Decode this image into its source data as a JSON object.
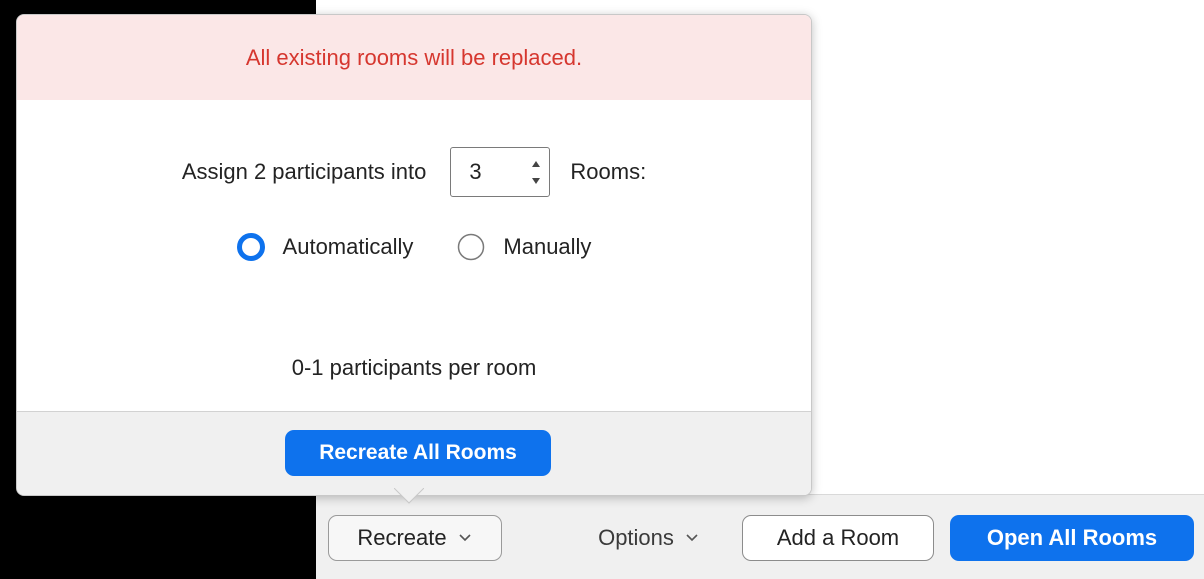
{
  "popover": {
    "warning": "All existing rooms will be replaced.",
    "assign_prefix": "Assign 2 participants into",
    "rooms_count": "3",
    "rooms_suffix": "Rooms:",
    "options": [
      {
        "label": "Automatically",
        "selected": true
      },
      {
        "label": "Manually",
        "selected": false
      }
    ],
    "per_room_text": "0-1 participants per room",
    "primary_button": "Recreate All Rooms"
  },
  "toolbar": {
    "recreate_label": "Recreate",
    "options_label": "Options",
    "add_room_label": "Add a Room",
    "open_all_label": "Open All Rooms"
  },
  "colors": {
    "accent": "#0e72ed",
    "warning_text": "#d6372f",
    "warning_bg": "#fbe7e7"
  },
  "icons": {
    "dropdown": "chevron-down-icon",
    "stepper_up": "caret-up-icon",
    "stepper_down": "caret-down-icon",
    "radio_selected": "radio-selected-icon",
    "radio_unselected": "radio-unselected-icon"
  }
}
